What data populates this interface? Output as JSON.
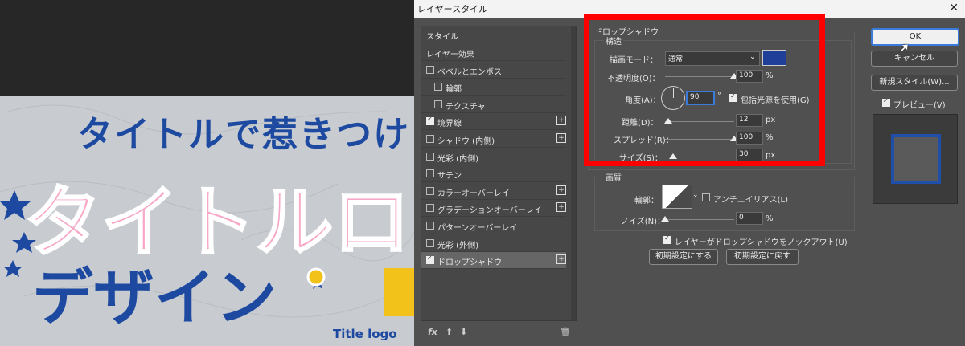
{
  "canvas": {
    "artwork_text": {
      "line1": "タイトルで惹きつけ",
      "line2": "タイトルロ",
      "line3": "デザイン",
      "caption": "Title logo"
    }
  },
  "dialog": {
    "title": "レイヤースタイル",
    "style_list": {
      "header": "スタイル",
      "items": [
        {
          "label": "レイヤー効果",
          "checkbox": false,
          "checked": false,
          "plus": false
        },
        {
          "label": "ベベルとエンボス",
          "checkbox": true,
          "checked": false,
          "plus": false
        },
        {
          "label": "輪郭",
          "checkbox": true,
          "checked": false,
          "plus": false
        },
        {
          "label": "テクスチャ",
          "checkbox": true,
          "checked": false,
          "plus": false
        },
        {
          "label": "境界線",
          "checkbox": true,
          "checked": true,
          "plus": true
        },
        {
          "label": "シャドウ (内側)",
          "checkbox": true,
          "checked": false,
          "plus": true
        },
        {
          "label": "光彩 (内側)",
          "checkbox": true,
          "checked": false,
          "plus": false
        },
        {
          "label": "サテン",
          "checkbox": true,
          "checked": false,
          "plus": false
        },
        {
          "label": "カラーオーバーレイ",
          "checkbox": true,
          "checked": false,
          "plus": true
        },
        {
          "label": "グラデーションオーバーレイ",
          "checkbox": true,
          "checked": false,
          "plus": true
        },
        {
          "label": "パターンオーバーレイ",
          "checkbox": true,
          "checked": false,
          "plus": false
        },
        {
          "label": "光彩 (外側)",
          "checkbox": true,
          "checked": false,
          "plus": false
        },
        {
          "label": "ドロップシャドウ",
          "checkbox": true,
          "checked": true,
          "plus": true,
          "selected": true
        }
      ],
      "fx_label": "fx"
    },
    "drop_shadow": {
      "title": "ドロップシャドウ",
      "structure_title": "構造",
      "blend_mode_label": "描画モード：",
      "blend_mode_value": "通常",
      "shadow_color": "#1f3f99",
      "opacity_label": "不透明度(O)：",
      "opacity_value": "100",
      "opacity_percent": 100,
      "angle_label": "角度(A)：",
      "angle_value": "90",
      "degree_symbol": "°",
      "global_light_label": "包括光源を使用(G)",
      "distance_label": "距離(D)：",
      "distance_value": "12",
      "distance_percent": 5,
      "spread_label": "スプレッド(R)：",
      "spread_value": "100",
      "spread_percent": 100,
      "size_label": "サイズ(S)：",
      "size_value": "30",
      "size_percent": 12,
      "unit_px": "px",
      "unit_percent": "%"
    },
    "quality": {
      "title": "画質",
      "contour_label": "輪郭：",
      "antialias_label": "アンチエイリアス(L)",
      "noise_label": "ノイズ(N)：",
      "noise_value": "0",
      "noise_percent": 0,
      "unit_percent": "%"
    },
    "knockout_label": "レイヤーがドロップシャドウをノックアウト(U)",
    "make_default_label": "初期設定にする",
    "reset_default_label": "初期設定に戻す",
    "ok_label": "OK",
    "cancel_label": "キャンセル",
    "new_style_label": "新規スタイル(W)...",
    "preview_label": "プレビュー(V)",
    "highlight_color": "#ff0000",
    "accent_color": "#1f4fa8"
  }
}
